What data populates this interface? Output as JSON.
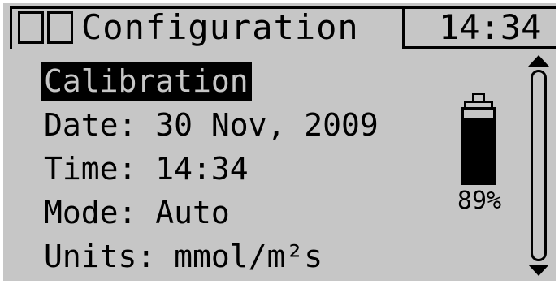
{
  "header": {
    "title": "Configuration",
    "time": "14:34",
    "icons": [
      "empty-box-icon",
      "empty-box-icon"
    ]
  },
  "menu": {
    "items": [
      {
        "label": "Calibration",
        "selected": true
      },
      {
        "label": "Date: 30 Nov, 2009",
        "selected": false
      },
      {
        "label": "Time: 14:34",
        "selected": false
      },
      {
        "label": "Mode: Auto",
        "selected": false
      },
      {
        "label": "Units: mmol/m²s",
        "selected": false
      }
    ]
  },
  "battery": {
    "label": "89%",
    "level": 0.89,
    "icon": "battery-icon"
  },
  "scrollbar": {
    "up_icon": "arrow-up-icon",
    "down_icon": "arrow-down-icon"
  },
  "colors": {
    "screen_background": "#c6c6c6",
    "foreground": "#000000"
  }
}
